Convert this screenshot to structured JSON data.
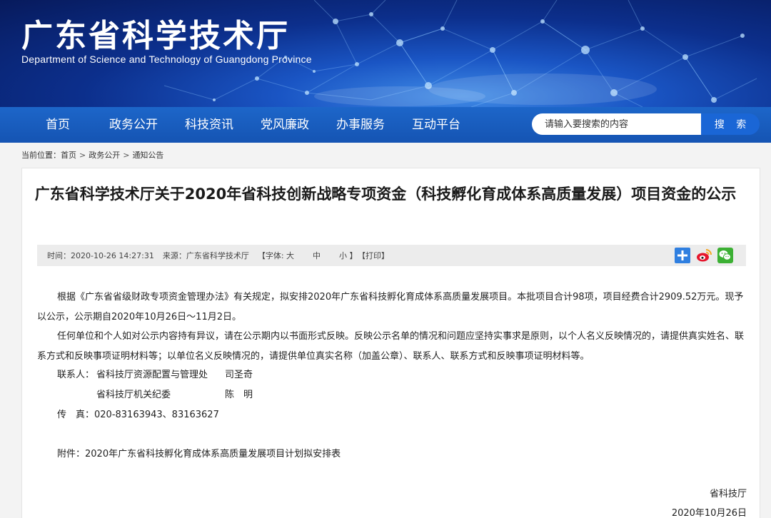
{
  "header": {
    "title": "广东省科学技术厅",
    "subtitle": "Department of Science and Technology of Guangdong Province"
  },
  "nav": {
    "items": [
      "首页",
      "政务公开",
      "科技资讯",
      "党风廉政",
      "办事服务",
      "互动平台"
    ],
    "search_placeholder": "请输入要搜索的内容",
    "search_button": "搜 索"
  },
  "breadcrumb": {
    "prefix": "当前位置：",
    "items": [
      "首页",
      "政务公开",
      "通知公告"
    ],
    "separator": ">"
  },
  "article": {
    "title": "广东省科学技术厅关于2020年省科技创新战略专项资金（科技孵化育成体系高质量发展）项目资金的公示",
    "meta": {
      "time": "时间：2020-10-26 14:27:31",
      "source": "来源：广东省科学技术厅",
      "font_label": "【字体:",
      "font_large": "大",
      "font_medium": "中",
      "font_small": "小",
      "font_close": "】",
      "print": "【打印】"
    },
    "share_icons": [
      "share-plus-icon",
      "weibo-icon",
      "wechat-icon"
    ],
    "paragraphs": [
      "根据《广东省省级财政专项资金管理办法》有关规定，拟安排2020年广东省科技孵化育成体系高质量发展项目。本批项目合计98项，项目经费合计2909.52万元。现予以公示，公示期自2020年10月26日～11月2日。",
      "任何单位和个人如对公示内容持有异议，请在公示期内以书面形式反映。反映公示名单的情况和问题应坚持实事求是原则，以个人名义反映情况的，请提供真实姓名、联系方式和反映事项证明材料等；以单位名义反映情况的，请提供单位真实名称（加盖公章）、联系人、联系方式和反映事项证明材料等。"
    ],
    "contact_label": "联系人：",
    "contacts": [
      {
        "dept": "省科技厅资源配置与管理处",
        "name": "司圣奇"
      },
      {
        "dept": "省科技厅机关纪委",
        "name": "陈　明"
      }
    ],
    "fax": "传　真：020-83163943、83163627",
    "attachment": "附件：2020年广东省科技孵化育成体系高质量发展项目计划拟安排表",
    "signature": "省科技厅",
    "date": "2020年10月26日"
  },
  "colors": {
    "nav_bg": "#1d66c9",
    "search_button": "#1a66d6",
    "banner_dark": "#071a5c"
  }
}
